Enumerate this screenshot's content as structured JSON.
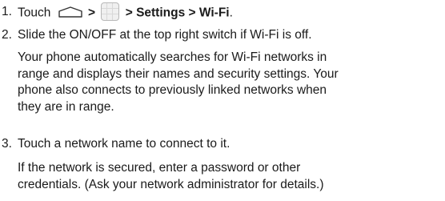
{
  "steps": [
    {
      "number": "1.",
      "prefix": "Touch",
      "sep1": ">",
      "sep2": ">",
      "bold_path": "Settings > Wi-Fi",
      "end": ".",
      "icons": [
        "home-outline-icon",
        "apps-grid-icon"
      ]
    },
    {
      "number": "2.",
      "text": "Slide the ON/OFF at the top right switch if Wi-Fi is off.",
      "note_lines": [
        "Your phone automatically searches for Wi-Fi networks in",
        "range and displays their names and security settings. Your",
        "phone also connects to previously linked networks when",
        "they are in range."
      ]
    },
    {
      "number": "3.",
      "text": "Touch a network name to connect to it.",
      "note_lines": [
        "If the network is secured, enter a password or other",
        "credentials. (Ask your network administrator for details.)"
      ]
    }
  ]
}
